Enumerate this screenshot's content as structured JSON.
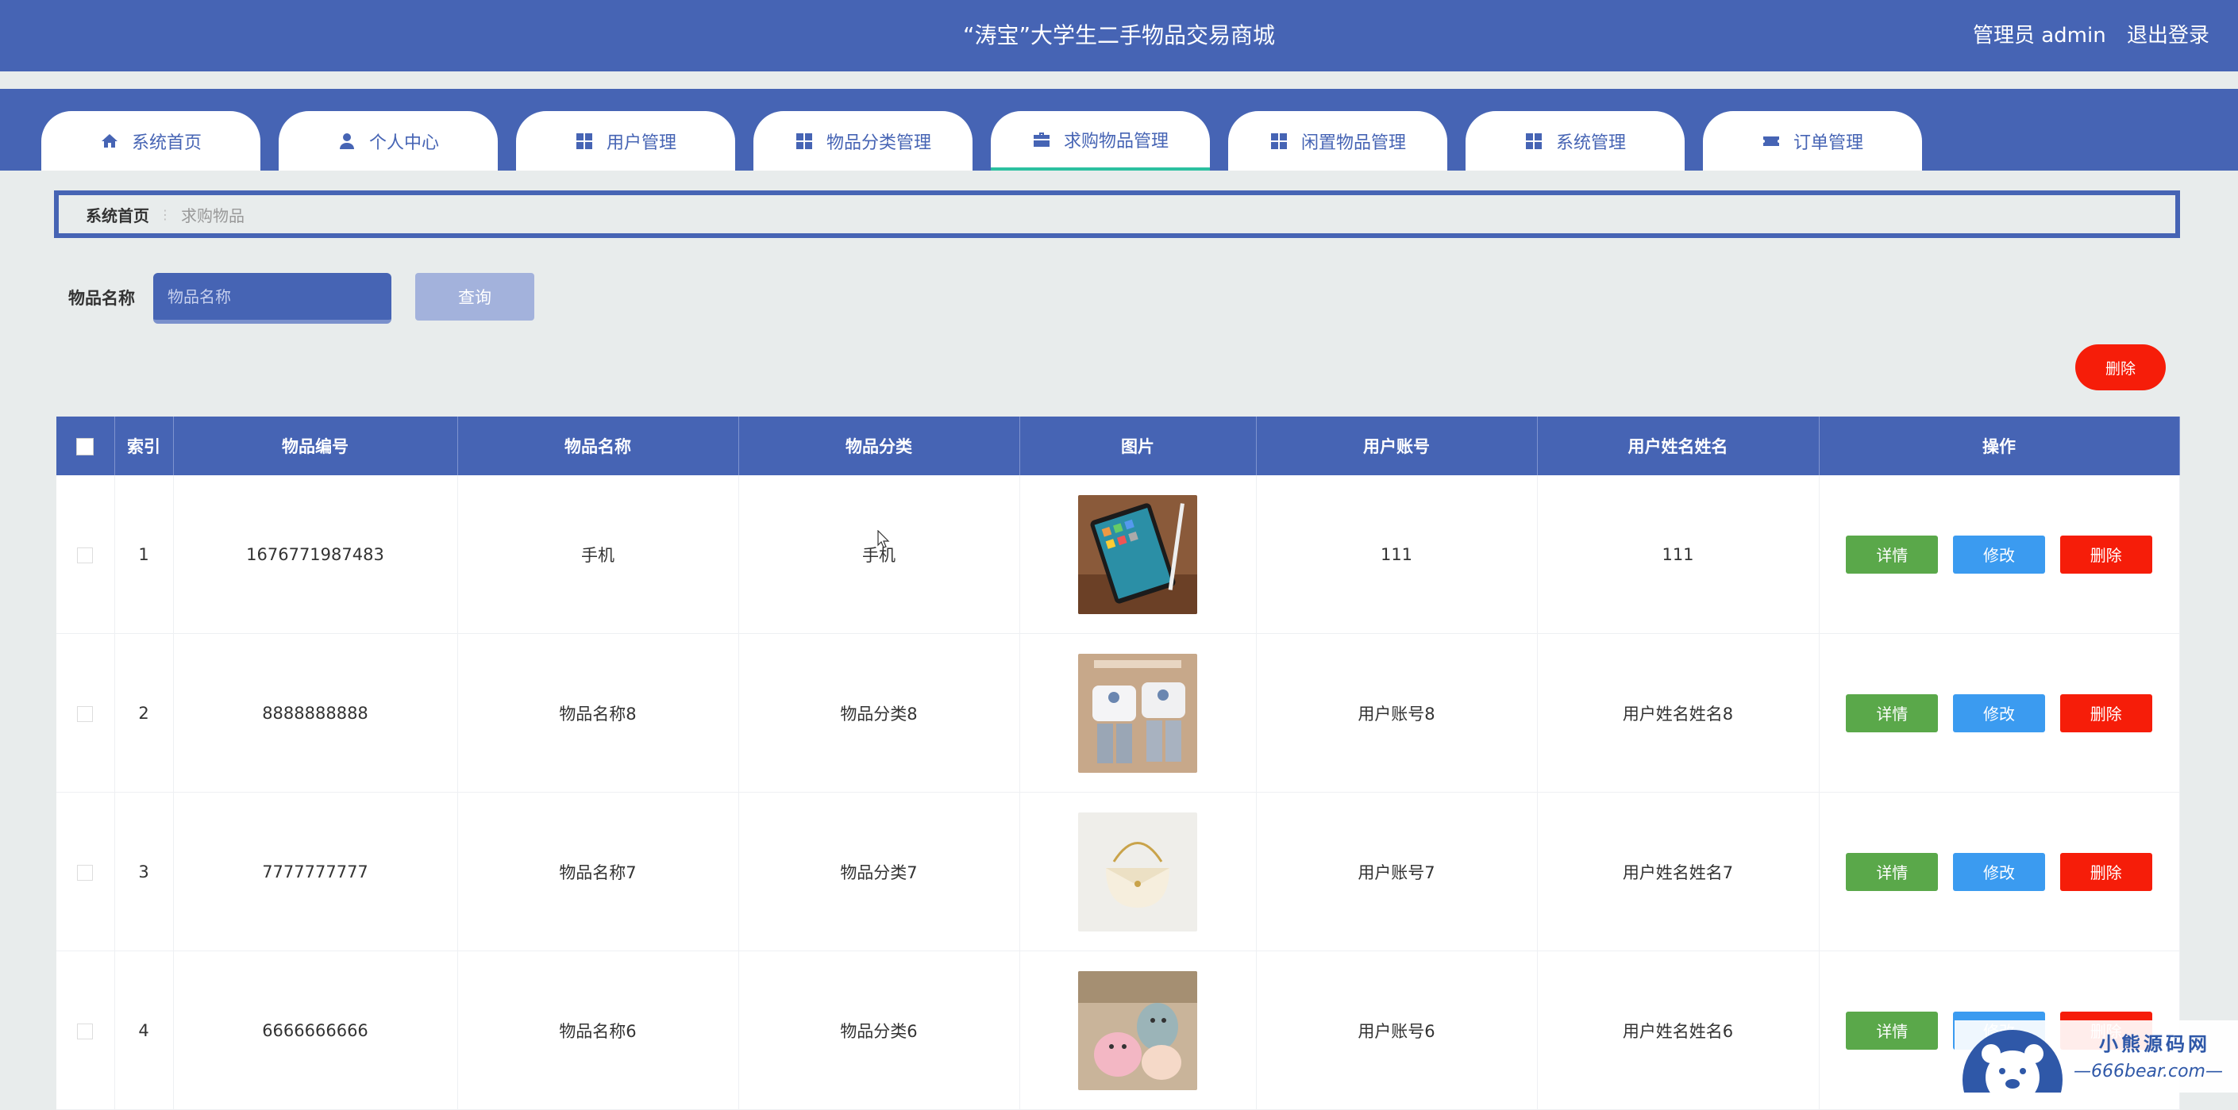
{
  "header": {
    "title": "“涛宝”大学生二手物品交易商城",
    "user": "管理员 admin",
    "logout": "退出登录"
  },
  "nav": {
    "tabs": [
      {
        "label": "系统首页",
        "icon": "home-icon"
      },
      {
        "label": "个人中心",
        "icon": "user-icon"
      },
      {
        "label": "用户管理",
        "icon": "grid-icon"
      },
      {
        "label": "物品分类管理",
        "icon": "grid-icon"
      },
      {
        "label": "求购物品管理",
        "icon": "briefcase-icon",
        "active": true
      },
      {
        "label": "闲置物品管理",
        "icon": "grid-icon"
      },
      {
        "label": "系统管理",
        "icon": "grid-icon"
      },
      {
        "label": "订单管理",
        "icon": "ticket-icon"
      }
    ]
  },
  "breadcrumb": {
    "home": "系统首页",
    "current": "求购物品"
  },
  "search": {
    "label": "物品名称",
    "placeholder": "物品名称",
    "button": "查询"
  },
  "toolbar": {
    "delete_label": "删除"
  },
  "table": {
    "headers": [
      "索引",
      "物品编号",
      "物品名称",
      "物品分类",
      "图片",
      "用户账号",
      "用户姓名姓名",
      "操作"
    ],
    "rows": [
      {
        "index": "1",
        "code": "1676771987483",
        "name": "手机",
        "category": "手机",
        "account": "111",
        "username": "111"
      },
      {
        "index": "2",
        "code": "8888888888",
        "name": "物品名称8",
        "category": "物品分类8",
        "account": "用户账号8",
        "username": "用户姓名姓名8"
      },
      {
        "index": "3",
        "code": "7777777777",
        "name": "物品名称7",
        "category": "物品分类7",
        "account": "用户账号7",
        "username": "用户姓名姓名7"
      },
      {
        "index": "4",
        "code": "6666666666",
        "name": "物品名称6",
        "category": "物品分类6",
        "account": "用户账号6",
        "username": "用户姓名姓名6"
      }
    ],
    "actions": {
      "detail": "详情",
      "edit": "修改",
      "delete": "删除"
    }
  },
  "watermark": {
    "cn": "小熊源码网",
    "en": "666bear.com"
  },
  "colors": {
    "primary": "#4664b4",
    "accent_tab": "#2cc0a0",
    "danger": "#f61d09",
    "success": "#5aa84a",
    "info": "#3b9bf0"
  }
}
